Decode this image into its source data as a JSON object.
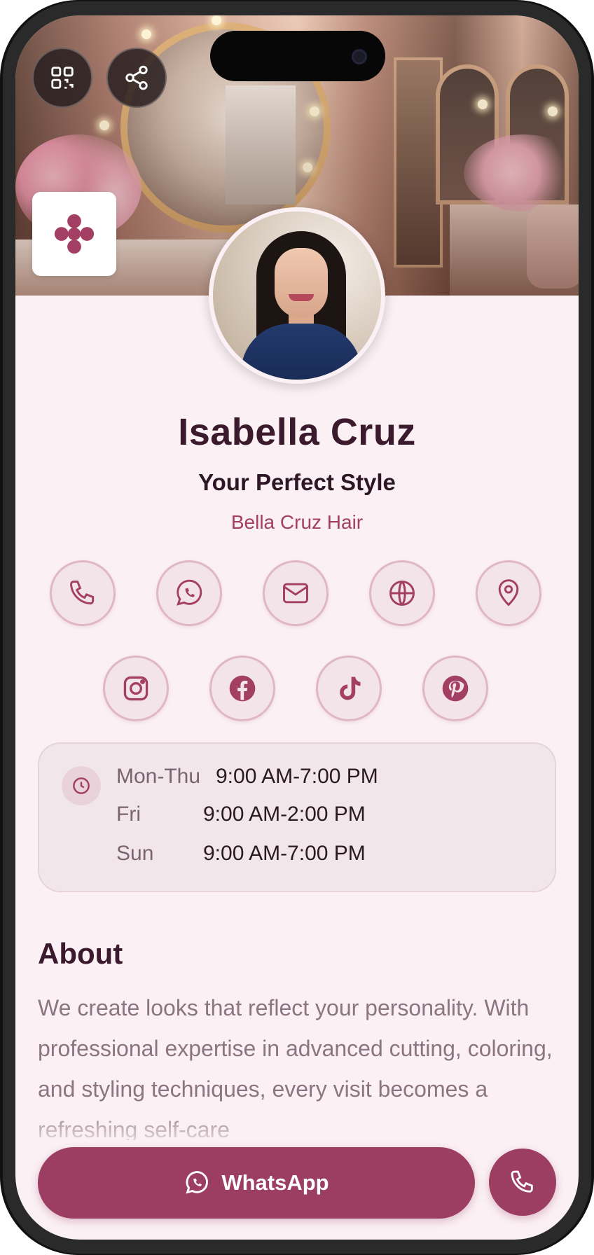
{
  "profile": {
    "name": "Isabella Cruz",
    "tagline": "Your Perfect Style",
    "company": "Bella Cruz Hair"
  },
  "top_buttons": {
    "qr_icon": "qr-code-icon",
    "share_icon": "share-icon"
  },
  "contact_icons": [
    "phone-icon",
    "whatsapp-icon",
    "email-icon",
    "globe-icon",
    "location-pin-icon"
  ],
  "social_icons": [
    "instagram-icon",
    "facebook-icon",
    "tiktok-icon",
    "pinterest-icon"
  ],
  "hours": [
    {
      "day": "Mon-Thu",
      "time": "9:00 AM-7:00 PM"
    },
    {
      "day": "Fri",
      "time": "9:00 AM-2:00 PM"
    },
    {
      "day": "Sun",
      "time": "9:00 AM-7:00 PM"
    }
  ],
  "about": {
    "title": "About",
    "text": "We create looks that reflect your personality. With professional expertise in advanced cutting, coloring, and styling techniques, every visit becomes a refreshing self-care"
  },
  "actions": {
    "whatsapp_label": "WhatsApp",
    "call_icon": "phone-icon"
  },
  "colors": {
    "accent": "#9c3d62",
    "background": "#fbf1f4",
    "text_dark": "#3a1a2c",
    "company": "#a43f64"
  }
}
